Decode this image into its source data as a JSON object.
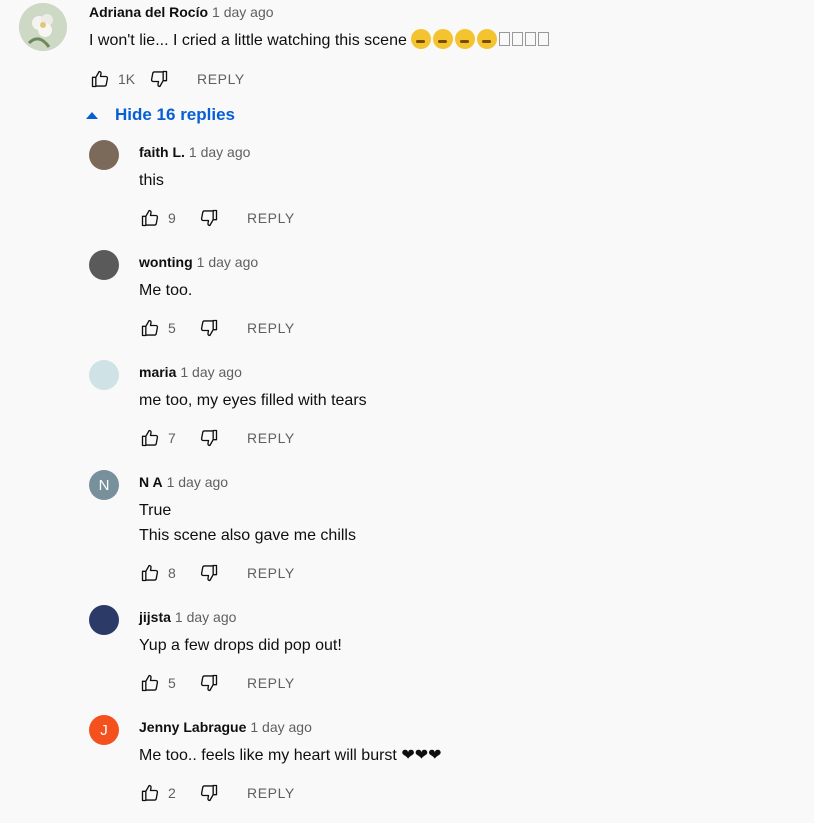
{
  "parent": {
    "author": "Adriana del Rocío",
    "time": "1 day ago",
    "text": "I won't lie... I cried a little watching this scene",
    "emoji_count": 4,
    "missing_glyph_count": 4,
    "likes": "1K",
    "reply_label": "REPLY",
    "hide_replies_label": "Hide 16 replies"
  },
  "replies": [
    {
      "author": "faith L.",
      "time": "1 day ago",
      "lines": [
        "this"
      ],
      "likes": "9",
      "reply_label": "REPLY",
      "avatar_color": "#7b6a5a"
    },
    {
      "author": "wonting",
      "time": "1 day ago",
      "lines": [
        "Me too."
      ],
      "likes": "5",
      "reply_label": "REPLY",
      "avatar_color": "#5a5a5a"
    },
    {
      "author": "maria",
      "time": "1 day ago",
      "lines": [
        "me too, my eyes filled with tears"
      ],
      "likes": "7",
      "reply_label": "REPLY",
      "avatar_color": "#cfe3e6"
    },
    {
      "author": "N A",
      "time": "1 day ago",
      "lines": [
        "True",
        "This scene also gave me chills"
      ],
      "likes": "8",
      "reply_label": "REPLY",
      "avatar_letter": "N",
      "avatar_color": "#78909c"
    },
    {
      "author": "jijsta",
      "time": "1 day ago",
      "lines": [
        "Yup a few drops did pop out!"
      ],
      "likes": "5",
      "reply_label": "REPLY",
      "avatar_color": "#2b3a67"
    },
    {
      "author": "Jenny Labrague",
      "time": "1 day ago",
      "lines": [
        "Me too.. feels like my heart will burst ❤❤❤"
      ],
      "likes": "2",
      "reply_label": "REPLY",
      "avatar_letter": "J",
      "avatar_color": "#f4511e"
    }
  ],
  "icons": {
    "like": "thumbs-up-icon",
    "dislike": "thumbs-down-icon",
    "expand": "caret-up-icon"
  }
}
